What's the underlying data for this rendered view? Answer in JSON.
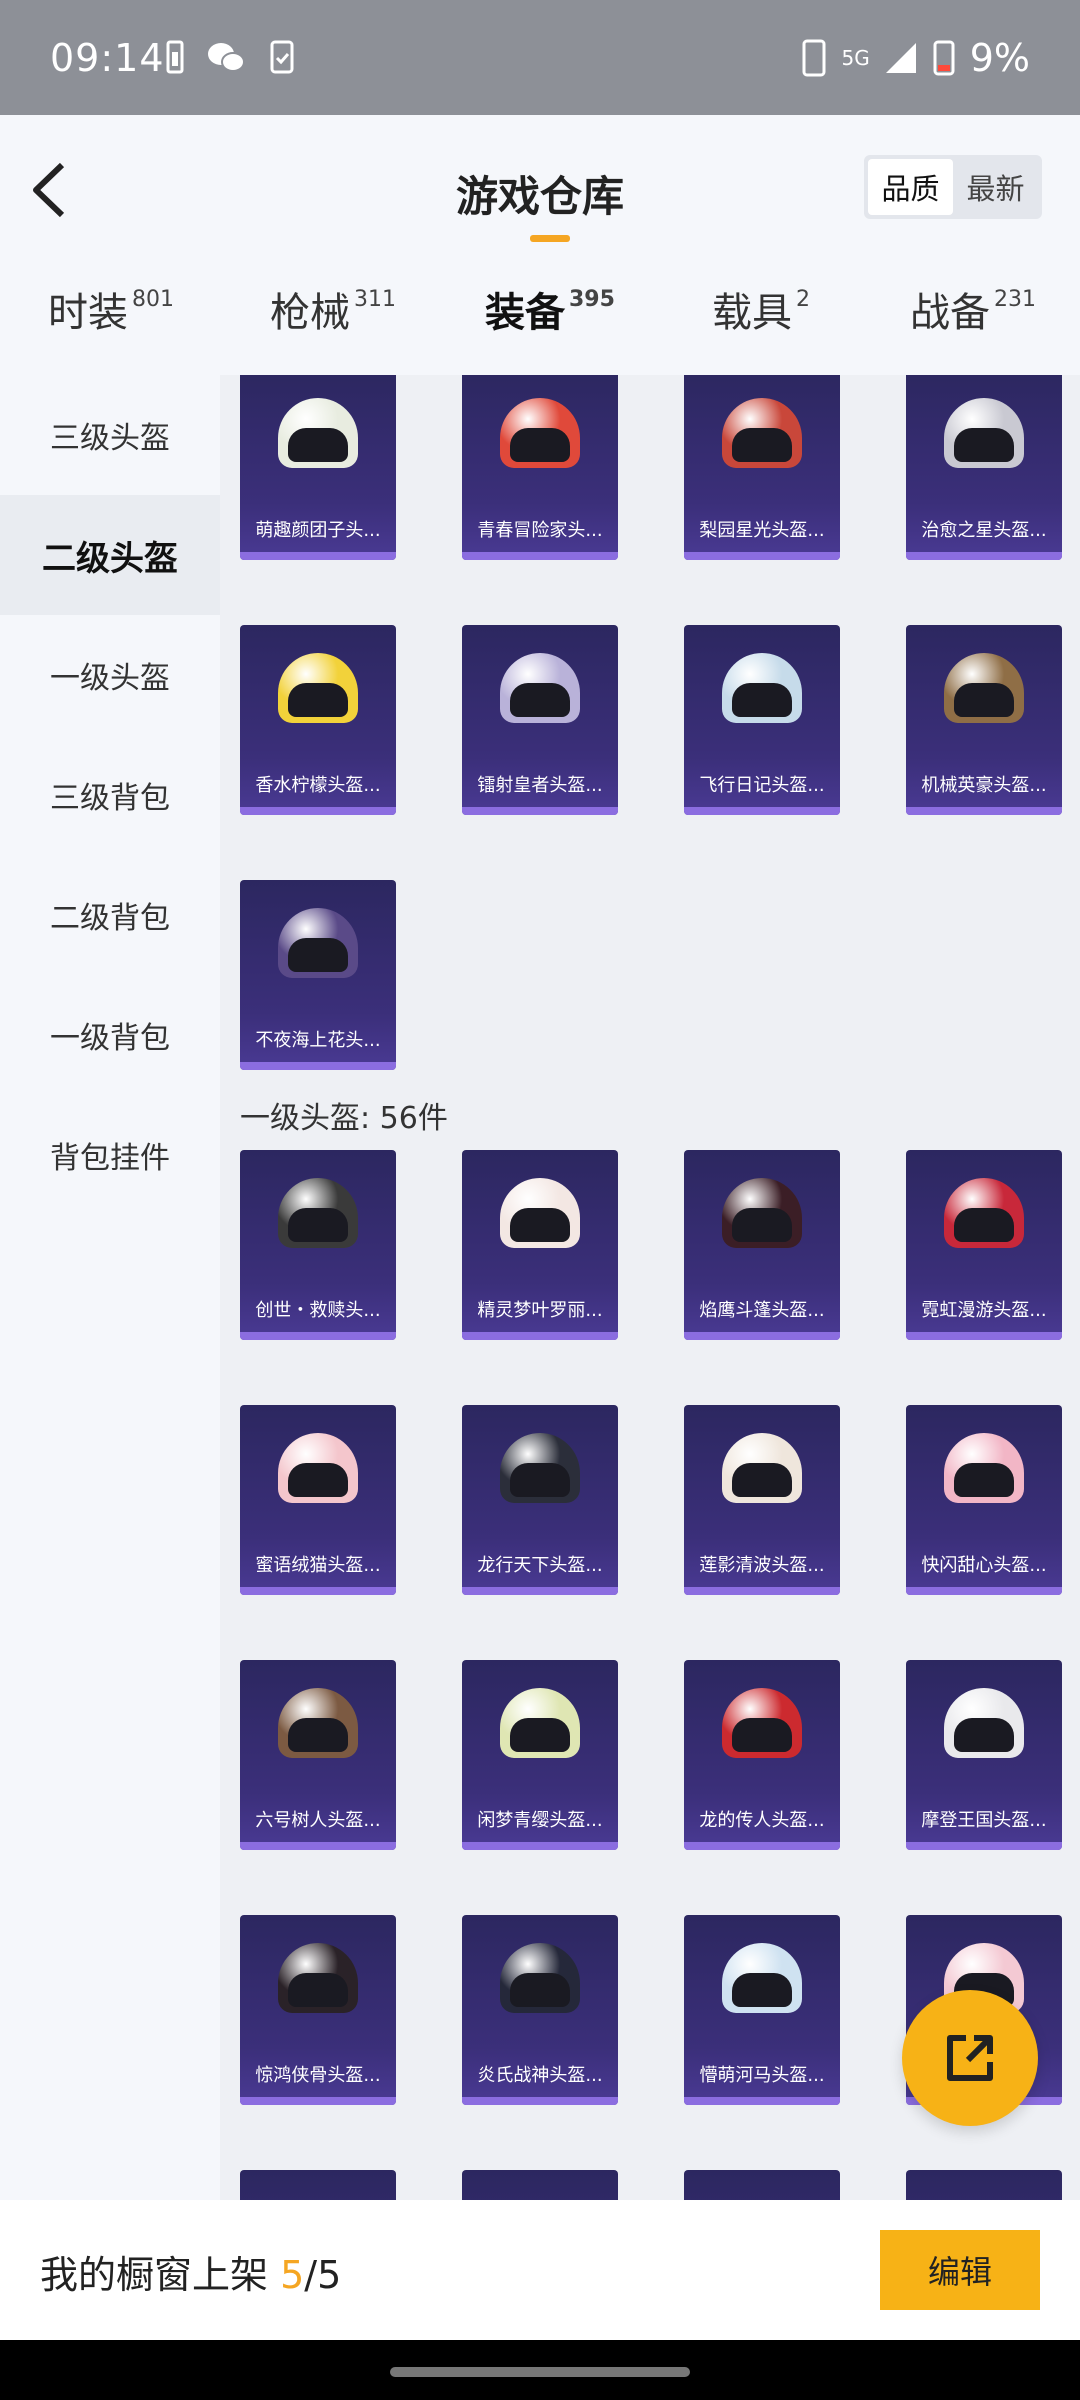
{
  "status_bar": {
    "time": "09:14",
    "network": "5G",
    "battery": "9%"
  },
  "header": {
    "title": "游戏仓库",
    "sort_options": [
      "品质",
      "最新"
    ],
    "sort_selected": "品质"
  },
  "tabs": [
    {
      "label": "时装",
      "count": "801"
    },
    {
      "label": "枪械",
      "count": "311"
    },
    {
      "label": "装备",
      "count": "395",
      "active": true
    },
    {
      "label": "载具",
      "count": "2"
    },
    {
      "label": "战备",
      "count": "231"
    }
  ],
  "sidebar": {
    "items": [
      {
        "label": "三级头盔"
      },
      {
        "label": "二级头盔",
        "active": true
      },
      {
        "label": "一级头盔"
      },
      {
        "label": "三级背包"
      },
      {
        "label": "二级背包"
      },
      {
        "label": "一级背包"
      },
      {
        "label": "背包挂件"
      }
    ]
  },
  "grid": {
    "items_top": [
      {
        "name": "萌趣颜团子头...",
        "color": "#e8ece0"
      },
      {
        "name": "青春冒险家头...",
        "color": "#e0493a"
      },
      {
        "name": "梨园星光头盔...",
        "color": "#c9473a"
      },
      {
        "name": "治愈之星头盔...",
        "color": "#c9c9d2"
      },
      {
        "name": "香水柠檬头盔...",
        "color": "#f2d23a"
      },
      {
        "name": "镭射皇者头盔...",
        "color": "#b9b2d9"
      },
      {
        "name": "飞行日记头盔...",
        "color": "#c6dbea"
      },
      {
        "name": "机械英豪头盔...",
        "color": "#8f6e46"
      },
      {
        "name": "不夜海上花头...",
        "color": "#5a4a88"
      }
    ],
    "section_title": "一级头盔: 56件",
    "items_level1": [
      {
        "name": "创世・救赎头...",
        "color": "#3a3a3a"
      },
      {
        "name": "精灵梦叶罗丽...",
        "color": "#f3e7e3"
      },
      {
        "name": "焰鹰斗篷头盔...",
        "color": "#3b1e26"
      },
      {
        "name": "霓虹漫游头盔...",
        "color": "#c8283a"
      },
      {
        "name": "蜜语绒猫头盔...",
        "color": "#f4c6cc"
      },
      {
        "name": "龙行天下头盔...",
        "color": "#2b2e3a"
      },
      {
        "name": "莲影清波头盔...",
        "color": "#efe6dc"
      },
      {
        "name": "快闪甜心头盔...",
        "color": "#f2b6c6"
      },
      {
        "name": "六号树人头盔...",
        "color": "#7c5a42"
      },
      {
        "name": "闲梦青缨头盔...",
        "color": "#dfe6b3"
      },
      {
        "name": "龙的传人头盔...",
        "color": "#cc2a2f"
      },
      {
        "name": "摩登王国头盔...",
        "color": "#e9e9ec"
      },
      {
        "name": "惊鸿侠骨头盔...",
        "color": "#2a2228"
      },
      {
        "name": "炎氏战神头盔...",
        "color": "#25283a"
      },
      {
        "name": "懵萌河马头盔...",
        "color": "#cfe2f1"
      },
      {
        "name": "",
        "color": "#f4c9d3"
      }
    ]
  },
  "bottom_bar": {
    "label_prefix": "我的橱窗上架",
    "shelf_count": "5",
    "shelf_total": "/5",
    "edit_label": "编辑"
  },
  "icons": {
    "back": "back-arrow-icon",
    "share": "share-external-icon"
  }
}
